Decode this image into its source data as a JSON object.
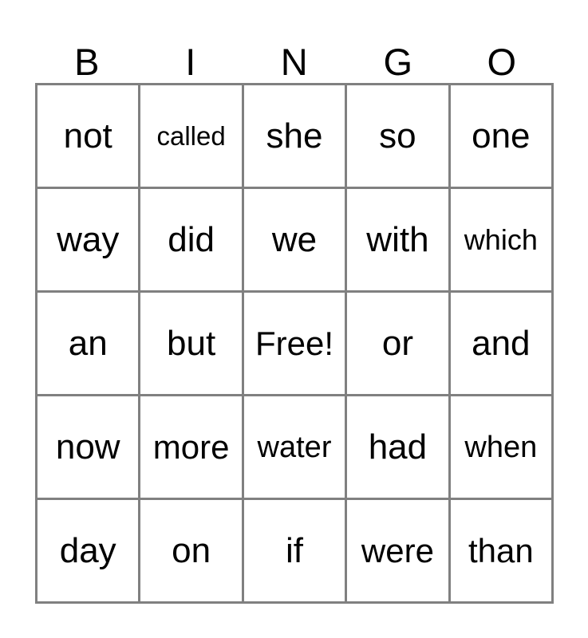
{
  "card": {
    "title_letters": [
      "B",
      "I",
      "N",
      "G",
      "O"
    ],
    "grid_line_color": "#808080",
    "text_color": "#000000",
    "background_color": "#ffffff",
    "rows": [
      [
        {
          "text": "not",
          "size": "fs-xl"
        },
        {
          "text": "called",
          "size": "fs-xs"
        },
        {
          "text": "she",
          "size": "fs-xl"
        },
        {
          "text": "so",
          "size": "fs-xl"
        },
        {
          "text": "one",
          "size": "fs-xl"
        }
      ],
      [
        {
          "text": "way",
          "size": "fs-xl"
        },
        {
          "text": "did",
          "size": "fs-xl"
        },
        {
          "text": "we",
          "size": "fs-xl"
        },
        {
          "text": "with",
          "size": "fs-xl"
        },
        {
          "text": "which",
          "size": "fs-sm"
        }
      ],
      [
        {
          "text": "an",
          "size": "fs-xl"
        },
        {
          "text": "but",
          "size": "fs-xl"
        },
        {
          "text": "Free!",
          "size": "fs-lg"
        },
        {
          "text": "or",
          "size": "fs-xl"
        },
        {
          "text": "and",
          "size": "fs-xl"
        }
      ],
      [
        {
          "text": "now",
          "size": "fs-xl"
        },
        {
          "text": "more",
          "size": "fs-lg"
        },
        {
          "text": "water",
          "size": "fs-md"
        },
        {
          "text": "had",
          "size": "fs-xl"
        },
        {
          "text": "when",
          "size": "fs-md"
        }
      ],
      [
        {
          "text": "day",
          "size": "fs-xl"
        },
        {
          "text": "on",
          "size": "fs-xl"
        },
        {
          "text": "if",
          "size": "fs-xl"
        },
        {
          "text": "were",
          "size": "fs-lg"
        },
        {
          "text": "than",
          "size": "fs-lg"
        }
      ]
    ]
  }
}
